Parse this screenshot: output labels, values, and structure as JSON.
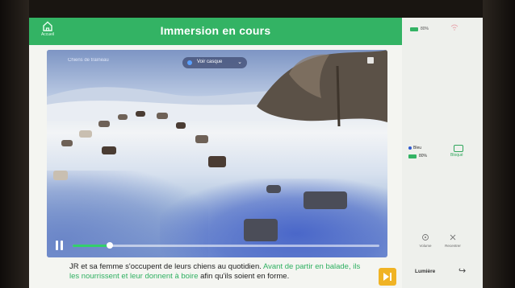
{
  "header": {
    "home_label": "Accueil",
    "title": "Immersion en cours"
  },
  "video": {
    "overlay_label": "Chiens de traîneau",
    "headset_selector": "Voir casque",
    "progress": 0.12
  },
  "caption": {
    "part1": "JR et sa femme s'occupent de leurs chiens au quotidien. ",
    "highlight": "Avant de partir en balade, ils les nourrissent et leur donnent à boire",
    "part2": " afin qu'ils soient en forme."
  },
  "sidebar": {
    "battery_text": "80%",
    "headset_name": "Bleu",
    "headset_battery": "80%",
    "headset_sub": "Bloqué",
    "tools": [
      "Volume",
      "Recentrer"
    ],
    "bottom_label": "Lumière"
  },
  "colors": {
    "brand": "#33b364",
    "next": "#f0b324",
    "highlight": "#2fb061"
  }
}
